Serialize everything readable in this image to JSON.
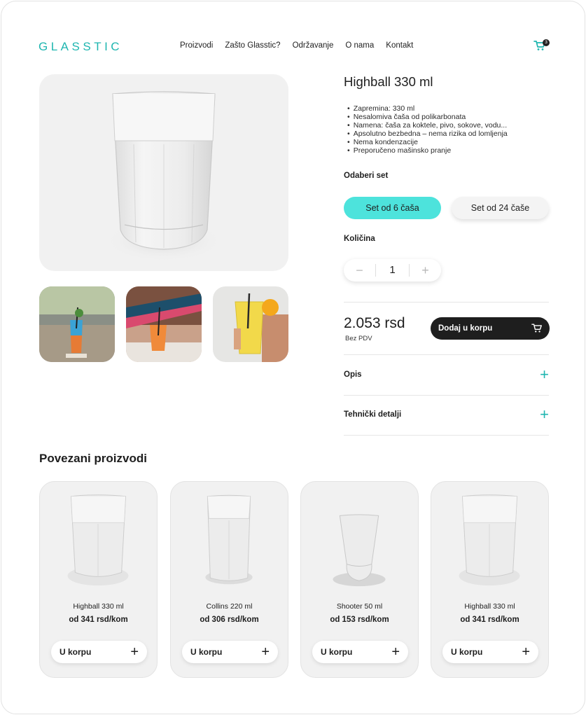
{
  "header": {
    "logo": "GLASSTIC",
    "nav": [
      "Proizvodi",
      "Zašto Glasstic?",
      "Održavanje",
      "O nama",
      "Kontakt"
    ],
    "cart_count": "3"
  },
  "product": {
    "title": "Highball 330 ml",
    "features": [
      "Zapremina: 330 ml",
      "Nesalomiva čaša od polikarbonata",
      "Namena: čaša za koktele, pivo, sokove, vodu...",
      "Apsolutno bezbedna – nema rizika od lomljenja",
      "Nema kondenzacije",
      "Preporučeno mašinsko pranje"
    ],
    "set_label": "Odaberi set",
    "set_options": [
      "Set od 6 čaša",
      "Set od 24 čaše"
    ],
    "selected_set": "Set od 6 čaša",
    "qty_label": "Količina",
    "qty_value": "1",
    "qty_minus": "−",
    "qty_plus": "+",
    "price": "2.053 rsd",
    "price_note": "Bez PDV",
    "add_to_cart": "Dodaj u korpu",
    "accordion": [
      "Opis",
      "Tehnički detalji"
    ]
  },
  "related": {
    "title": "Povezani proizvodi",
    "items": [
      {
        "name": "Highball 330 ml",
        "price": "od 341 rsd/kom",
        "button": "U korpu"
      },
      {
        "name": "Collins 220 ml",
        "price": "od 306 rsd/kom",
        "button": "U korpu"
      },
      {
        "name": "Shooter 50 ml",
        "price": "od 153 rsd/kom",
        "button": "U korpu"
      },
      {
        "name": "Highball 330 ml",
        "price": "od 341 rsd/kom",
        "button": "U korpu"
      }
    ]
  },
  "colors": {
    "accent": "#1fb6b0",
    "active_button": "#4de3dc",
    "dark_button": "#1e1e1e",
    "card_bg": "#f1f1f1"
  },
  "icons": [
    "cart-icon",
    "plus-icon",
    "minus-icon"
  ]
}
